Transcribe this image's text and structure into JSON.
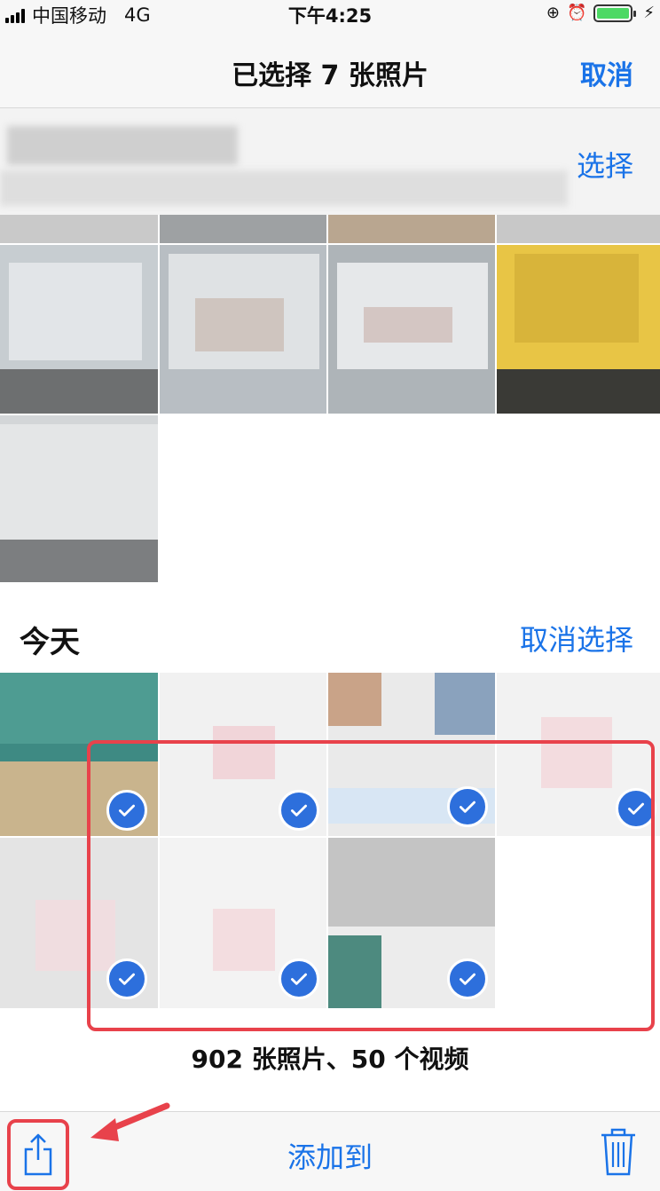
{
  "status_bar": {
    "carrier": "中国移动",
    "network": "4G",
    "time": "下午4:25"
  },
  "nav": {
    "title": "已选择 7 张照片",
    "cancel_label": "取消"
  },
  "section_top": {
    "select_label": "选择"
  },
  "section_today": {
    "title": "今天",
    "deselect_label": "取消选择"
  },
  "summary": "902 张照片、50 个视频",
  "toolbar": {
    "add_to_label": "添加到"
  },
  "icons": {
    "share": "share-icon",
    "trash": "trash-icon",
    "check": "checkmark-icon"
  },
  "colors": {
    "accent": "#1a73e8",
    "highlight": "#e8424b",
    "check": "#2d6fdc",
    "battery": "#4cd964"
  },
  "selected_photo_count": 7
}
